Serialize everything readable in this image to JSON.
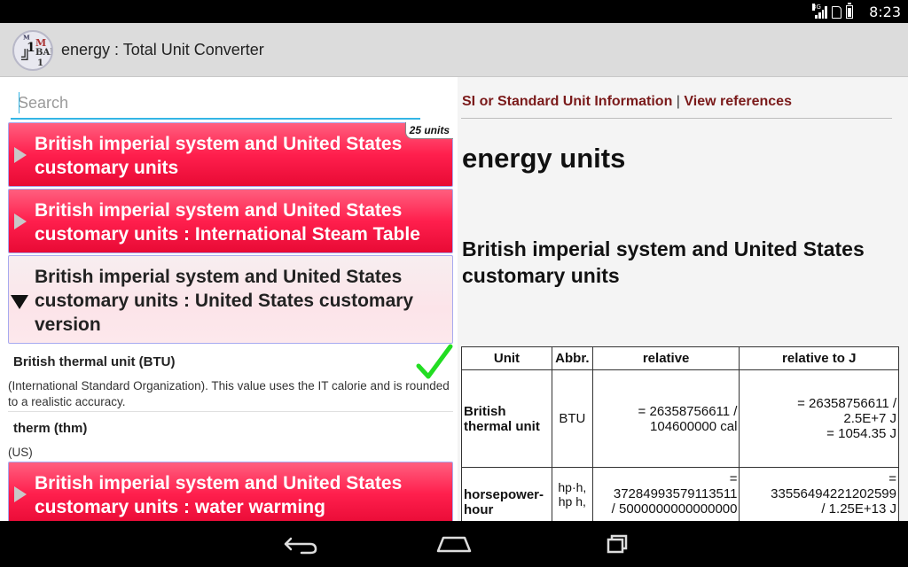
{
  "status": {
    "time": "8:23",
    "network_label": "3G"
  },
  "app": {
    "title": "energy : Total Unit Converter"
  },
  "search": {
    "placeholder": "Search"
  },
  "categories": [
    {
      "label": "British imperial system and United States customary units",
      "badge": "25 units",
      "expanded": false
    },
    {
      "label": "British imperial system and United States customary units : International Steam Table",
      "expanded": false
    },
    {
      "label": "British imperial system and United States customary units : United States customary version",
      "expanded": true
    },
    {
      "label": "British imperial system and United States customary units : water warming",
      "expanded": false
    }
  ],
  "units": [
    {
      "name": "British thermal unit (BTU)",
      "desc": "(International Standard Organization). This value uses the IT calorie and is rounded to a realistic accuracy.",
      "selected": true
    },
    {
      "name": "therm (thm)",
      "desc": "(US)",
      "selected": false
    }
  ],
  "info": {
    "link_si": "SI or Standard Unit Information",
    "separator": "|",
    "link_refs": "View references",
    "heading": "energy units",
    "section": "British imperial system and United States customary units",
    "table": {
      "headers": [
        "Unit",
        "Abbr.",
        "relative",
        "relative to J"
      ],
      "rows": [
        {
          "unit": "British thermal unit",
          "abbr": "BTU",
          "relative": [
            "= 26358756611 /",
            "104600000 cal"
          ],
          "relative_j": [
            "= 26358756611 /",
            "2.5E+7 J",
            "= 1054.35 J"
          ]
        },
        {
          "unit": "horsepower-hour",
          "abbr": "hp·h, hp h,",
          "relative": [
            "=",
            "37284993579113511",
            "/ 5000000000000000"
          ],
          "relative_j": [
            "=",
            "33556494221202599",
            "/ 1.25E+13 J"
          ]
        }
      ]
    }
  },
  "colors": {
    "category_red": "#ff1f4d",
    "accent_blue": "#33b5e5",
    "link_maroon": "#7a1a1a",
    "check_green": "#22dd22"
  }
}
